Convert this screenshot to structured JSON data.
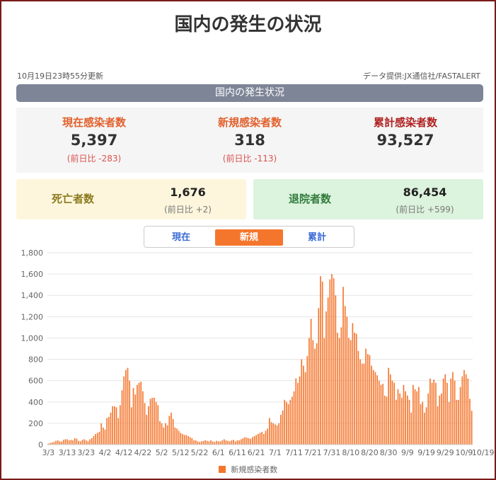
{
  "page": {
    "title": "国内の発生の状況"
  },
  "meta": {
    "updated": "10月19日23時55分更新",
    "source": "データ提供:JX通信社/FASTALERT"
  },
  "banner": {
    "label": "国内の発生状況"
  },
  "stats": {
    "current": {
      "label": "現在感染者数",
      "value": "5,397",
      "diff": "(前日比 -283)"
    },
    "new": {
      "label": "新規感染者数",
      "value": "318",
      "diff": "(前日比 -113)"
    },
    "total": {
      "label": "累計感染者数",
      "value": "93,527"
    }
  },
  "deaths": {
    "label": "死亡者数",
    "value": "1,676",
    "diff": "(前日比 +2)"
  },
  "recovered": {
    "label": "退院者数",
    "value": "86,454",
    "diff": "(前日比 +599)"
  },
  "tabs": {
    "current": "現在",
    "new": "新規",
    "total": "累計",
    "active": "新規"
  },
  "colors": {
    "bar": "#f4762d",
    "tab_active": "#f4762d",
    "tab_text": "#3a6ad6",
    "banner": "#7e8597"
  },
  "chart_data": {
    "type": "bar",
    "title": "",
    "xlabel": "",
    "ylabel": "",
    "ylim": [
      0,
      1800
    ],
    "yticks": [
      0,
      200,
      400,
      600,
      800,
      "1,000",
      "1,200",
      "1,400",
      "1,600",
      "1,800"
    ],
    "grid": true,
    "legend_position": "bottom",
    "x_tick_labels": [
      "3/3",
      "3/13",
      "3/23",
      "4/2",
      "4/12",
      "4/22",
      "5/2",
      "5/12",
      "5/22",
      "6/1",
      "6/11",
      "6/21",
      "7/1",
      "7/11",
      "7/21",
      "7/31",
      "8/10",
      "8/20",
      "8/30",
      "9/9",
      "9/19",
      "9/29",
      "10/9",
      "10/19"
    ],
    "start_label": "3/3",
    "series": [
      {
        "name": "新規感染者数",
        "values": [
          10,
          15,
          20,
          25,
          35,
          40,
          30,
          28,
          45,
          50,
          50,
          40,
          45,
          40,
          60,
          55,
          35,
          30,
          45,
          50,
          40,
          30,
          50,
          60,
          80,
          100,
          110,
          120,
          200,
          160,
          140,
          250,
          260,
          300,
          360,
          360,
          350,
          250,
          370,
          510,
          640,
          700,
          720,
          600,
          350,
          530,
          470,
          560,
          580,
          590,
          500,
          390,
          280,
          360,
          430,
          440,
          440,
          400,
          370,
          220,
          200,
          160,
          200,
          180,
          270,
          300,
          240,
          160,
          150,
          130,
          110,
          100,
          90,
          90,
          80,
          70,
          60,
          40,
          40,
          30,
          25,
          30,
          35,
          40,
          35,
          30,
          40,
          30,
          25,
          35,
          30,
          30,
          40,
          50,
          40,
          35,
          30,
          40,
          45,
          30,
          40,
          40,
          50,
          60,
          70,
          65,
          60,
          55,
          70,
          80,
          90,
          100,
          110,
          120,
          100,
          130,
          150,
          250,
          210,
          200,
          190,
          180,
          200,
          280,
          320,
          420,
          400,
          380,
          420,
          450,
          500,
          620,
          580,
          640,
          800,
          740,
          680,
          830,
          1000,
          1180,
          980,
          900,
          950,
          1280,
          1580,
          1530,
          1000,
          1250,
          1380,
          1550,
          1600,
          1560,
          1400,
          1050,
          1000,
          1100,
          1480,
          1300,
          1200,
          1000,
          980,
          1140,
          1050,
          1040,
          880,
          800,
          760,
          760,
          900,
          850,
          840,
          740,
          700,
          680,
          650,
          600,
          560,
          570,
          460,
          450,
          720,
          660,
          600,
          580,
          420,
          520,
          480,
          440,
          560,
          500,
          460,
          420,
          300,
          560,
          520,
          500,
          540,
          380,
          400,
          300,
          350,
          480,
          620,
          580,
          610,
          580,
          360,
          460,
          480,
          620,
          660,
          580,
          400,
          620,
          680,
          600,
          420,
          420,
          540,
          640,
          700,
          660,
          620,
          430,
          318
        ]
      }
    ]
  }
}
